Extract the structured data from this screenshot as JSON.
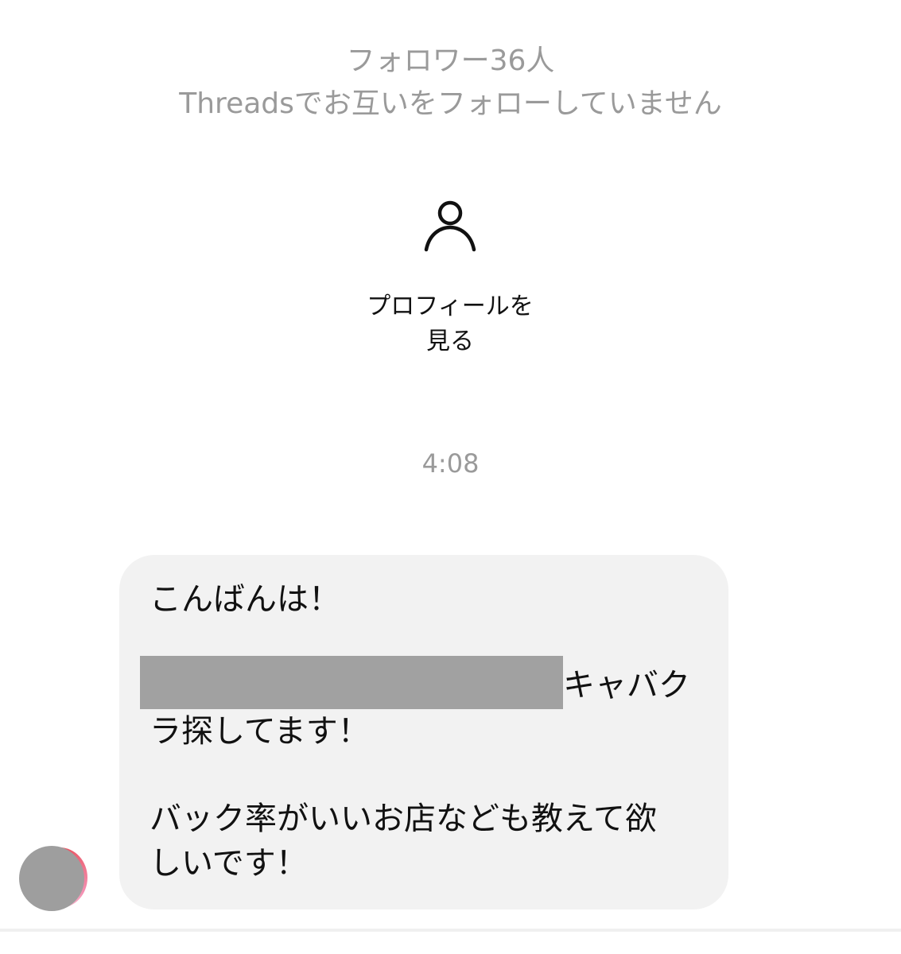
{
  "header": {
    "followers": "フォロワー36人",
    "threads_status": "Threadsでお互いをフォローしていません"
  },
  "profile": {
    "icon": "person-icon",
    "link_line1": "プロフィールを",
    "link_line2": "見る"
  },
  "timestamp": "4:08",
  "message": {
    "line1": "こんばんは！",
    "line2_after_redaction": "キャバク",
    "line3": "ラ探してます！",
    "line4": "バック率がいいお店なども教えて欲",
    "line5": "しいです！"
  },
  "colors": {
    "muted_text": "#9a9a9a",
    "bubble_bg": "#f2f2f2",
    "redaction": "#a1a1a1"
  }
}
